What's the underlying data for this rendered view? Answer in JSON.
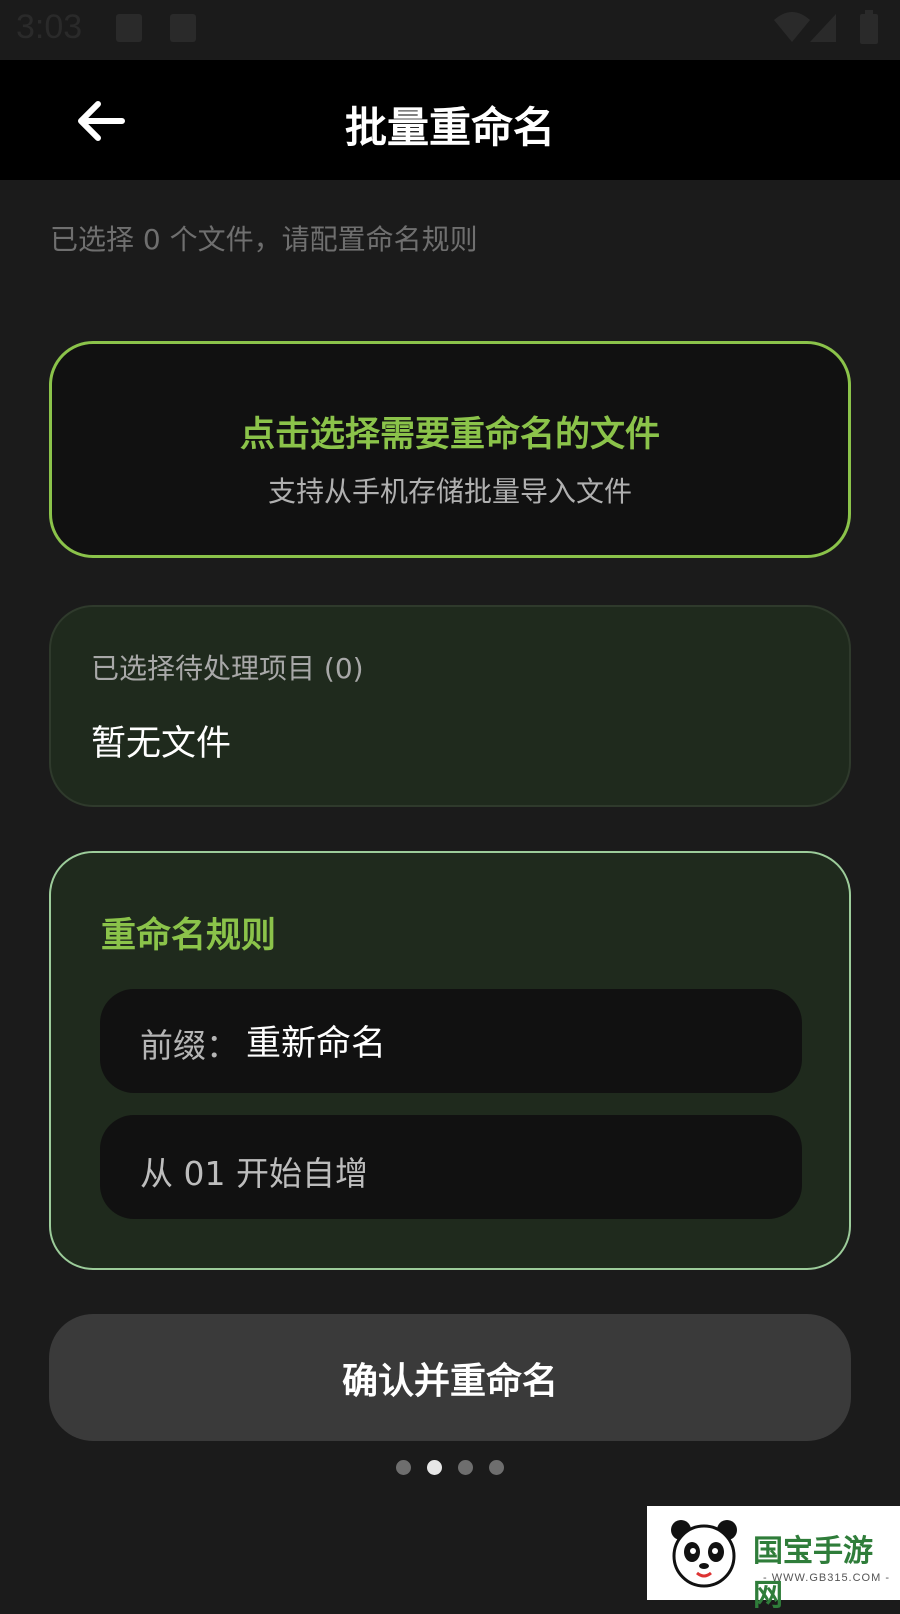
{
  "status_bar": {
    "time": "3:03",
    "icons": [
      "image-icon",
      "a-icon",
      "wifi-icon",
      "signal-icon",
      "battery-icon"
    ]
  },
  "header": {
    "title": "批量重命名",
    "back_icon": "arrow-left-icon"
  },
  "hint": "已选择 0 个文件，请配置命名规则",
  "pick_card": {
    "title": "点击选择需要重命名的文件",
    "subtitle": "支持从手机存储批量导入文件"
  },
  "selected": {
    "label": "已选择待处理项目 (0)",
    "empty_text": "暂无文件"
  },
  "rules": {
    "title": "重命名规则",
    "prefix_label": "前缀：",
    "prefix_value": "重新命名",
    "sequence_text": "从 01 开始自增"
  },
  "confirm_button": "确认并重命名",
  "pager": {
    "count": 4,
    "active_index": 1
  },
  "watermark": {
    "text": "国宝手游网",
    "url": "- WWW.GB315.COM -"
  },
  "colors": {
    "accent": "#8bc34a",
    "background": "#1b1b1b",
    "card": "#1f2a1d",
    "rules_border": "#9ccc9a"
  }
}
